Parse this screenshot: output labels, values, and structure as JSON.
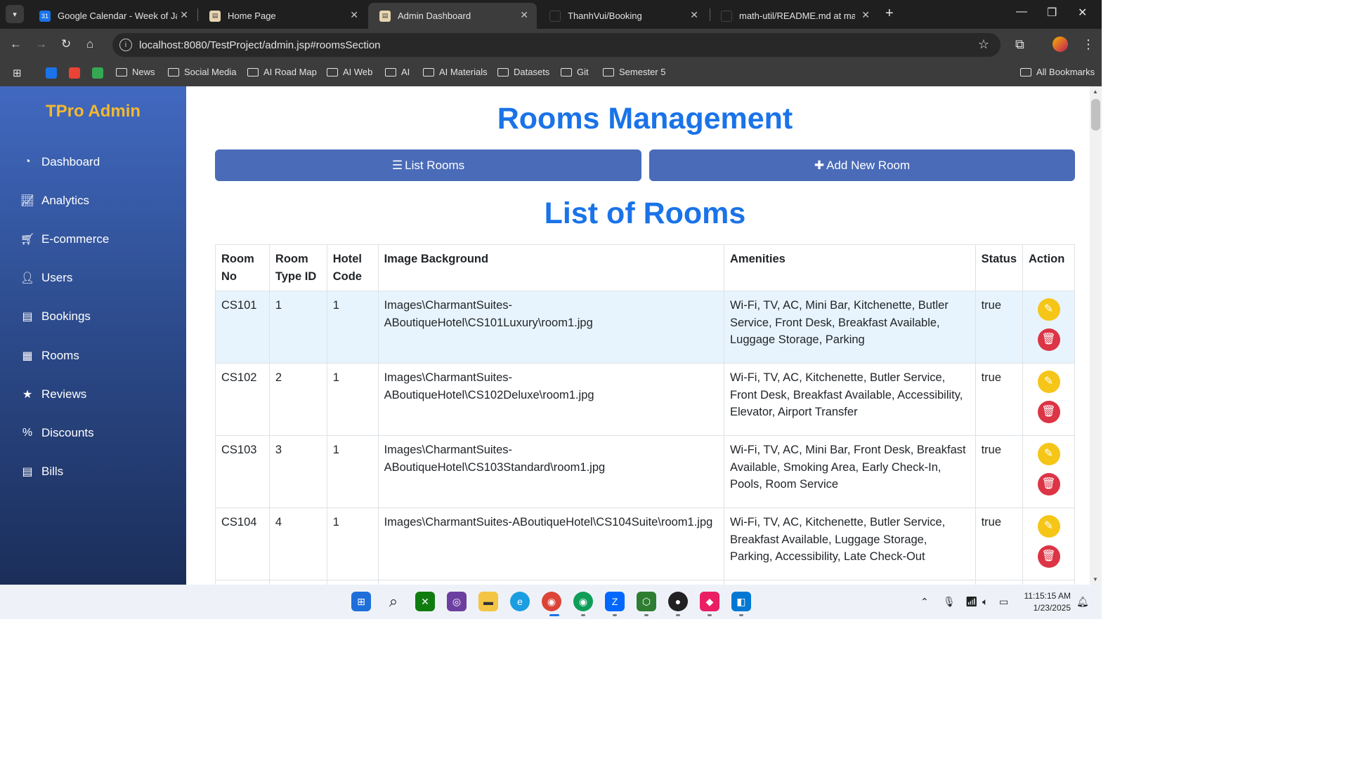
{
  "browser": {
    "tabs": [
      {
        "title": "Google Calendar - Week of January",
        "favicon": "calendar-icon",
        "active": false
      },
      {
        "title": "Home Page",
        "favicon": "page-icon",
        "active": false
      },
      {
        "title": "Admin Dashboard",
        "favicon": "page-icon",
        "active": true
      },
      {
        "title": "ThanhVui/Booking",
        "favicon": "github-icon",
        "active": false
      },
      {
        "title": "math-util/README.md at main",
        "favicon": "github-icon",
        "active": false
      }
    ],
    "url": "localhost:8080/TestProject/admin.jsp#roomsSection",
    "bookmarks": [
      "News",
      "Social Media",
      "AI Road Map",
      "AI Web",
      "AI",
      "AI Materials",
      "Datasets",
      "Git",
      "Semester 5"
    ],
    "all_bookmarks": "All Bookmarks"
  },
  "sidebar": {
    "brand": "TPro Admin",
    "items": [
      {
        "label": "Dashboard",
        "icon": "gauge-icon"
      },
      {
        "label": "Analytics",
        "icon": "chart-line-icon"
      },
      {
        "label": "E-commerce",
        "icon": "cart-icon"
      },
      {
        "label": "Users",
        "icon": "user-icon"
      },
      {
        "label": "Bookings",
        "icon": "book-icon"
      },
      {
        "label": "Rooms",
        "icon": "building-icon"
      },
      {
        "label": "Reviews",
        "icon": "star-icon"
      },
      {
        "label": "Discounts",
        "icon": "percent-icon"
      },
      {
        "label": "Bills",
        "icon": "file-invoice-icon"
      }
    ]
  },
  "main": {
    "title": "Rooms Management",
    "list_button": "List Rooms",
    "add_button": "Add New Room",
    "table_title": "List of Rooms",
    "columns": [
      "Room No",
      "Room Type ID",
      "Hotel Code",
      "Image Background",
      "Amenities",
      "Status",
      "Action"
    ],
    "rows": [
      {
        "room_no": "CS101",
        "room_type_id": "1",
        "hotel_code": "1",
        "image": "Images\\CharmantSuites-ABoutiqueHotel\\CS101Luxury\\room1.jpg",
        "amenities": "Wi-Fi, TV, AC, Mini Bar, Kitchenette, Butler Service, Front Desk, Breakfast Available, Luggage Storage, Parking",
        "status": "true"
      },
      {
        "room_no": "CS102",
        "room_type_id": "2",
        "hotel_code": "1",
        "image": "Images\\CharmantSuites-ABoutiqueHotel\\CS102Deluxe\\room1.jpg",
        "amenities": "Wi-Fi, TV, AC, Kitchenette, Butler Service, Front Desk, Breakfast Available, Accessibility, Elevator, Airport Transfer",
        "status": "true"
      },
      {
        "room_no": "CS103",
        "room_type_id": "3",
        "hotel_code": "1",
        "image": "Images\\CharmantSuites-ABoutiqueHotel\\CS103Standard\\room1.jpg",
        "amenities": "Wi-Fi, TV, AC, Mini Bar, Front Desk, Breakfast Available, Smoking Area, Early Check-In, Pools, Room Service",
        "status": "true"
      },
      {
        "room_no": "CS104",
        "room_type_id": "4",
        "hotel_code": "1",
        "image": "Images\\CharmantSuites-ABoutiqueHotel\\CS104Suite\\room1.jpg",
        "amenities": "Wi-Fi, TV, AC, Kitchenette, Butler Service, Breakfast Available, Luggage Storage, Parking, Accessibility, Late Check-Out",
        "status": "true"
      }
    ]
  },
  "taskbar": {
    "time": "11:15:15 AM",
    "date": "1/23/2025"
  },
  "colors": {
    "accent": "#1a73e8",
    "brand": "#f5b82e",
    "button": "#4a6bb8",
    "edit": "#f5c518",
    "delete": "#dc3545"
  }
}
